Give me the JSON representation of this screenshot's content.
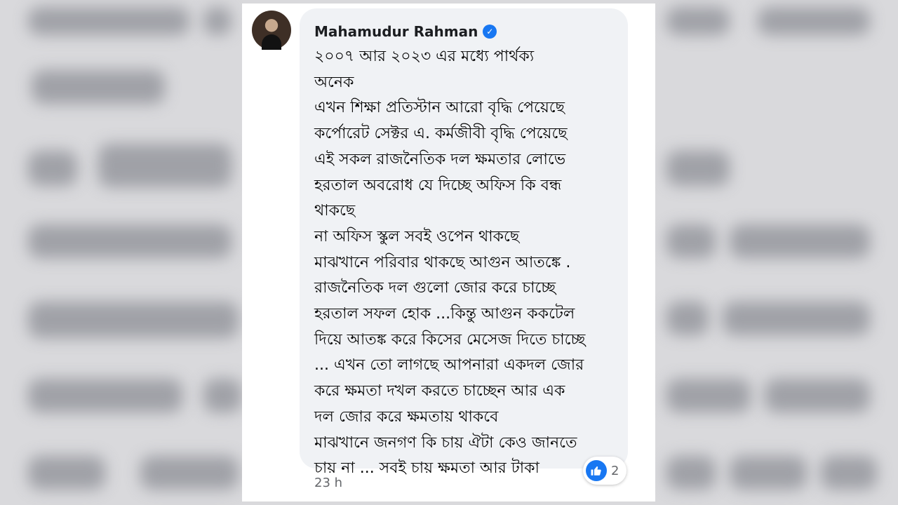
{
  "comment": {
    "author": "Mahamudur Rahman",
    "verified_icon": "verified-badge-icon",
    "lines": [
      "২০০৭ আর ২০২৩ এর মধ্যে পার্থক্য",
      "অনেক",
      "এখন শিক্ষা প্রতিস্টান আরো বৃদ্ধি পেয়েছে",
      "কর্পোরেট সেক্টর এ. কর্মজীবী বৃদ্ধি পেয়েছে",
      "এই সকল রাজনৈতিক দল ক্ষমতার লোভে",
      "হরতাল অবরোধ যে দিচ্ছে অফিস কি বন্ধ",
      "থাকছে",
      "না অফিস স্কুল সবই ওপেন থাকছে",
      "মাঝখানে পরিবার থাকছে আগুন আতঙ্কে .",
      "রাজনৈতিক দল গুলো জোর করে চাচ্ছে",
      "হরতাল সফল হোক ...কিন্তু আগুন ককটেল",
      "দিয়ে আতঙ্ক করে কিসের মেসেজ দিতে চাচ্ছে",
      "... এখন তো লাগছে আপনারা একদল জোর",
      "করে ক্ষমতা দখল করতে চাচ্ছেন আর এক",
      "দল জোর করে ক্ষমতায় থাকবে",
      "মাঝখানে জনগণ কি চায় ঐটা কেও জানতে",
      "চায় না ... সবই চায় ক্ষমতা আর টাকা"
    ],
    "reaction_icon": "like-icon",
    "reaction_count": "2",
    "timestamp": "23 h"
  },
  "colors": {
    "accent": "#1877f2",
    "bubble": "#f0f2f5",
    "meta_text": "#65676b"
  }
}
